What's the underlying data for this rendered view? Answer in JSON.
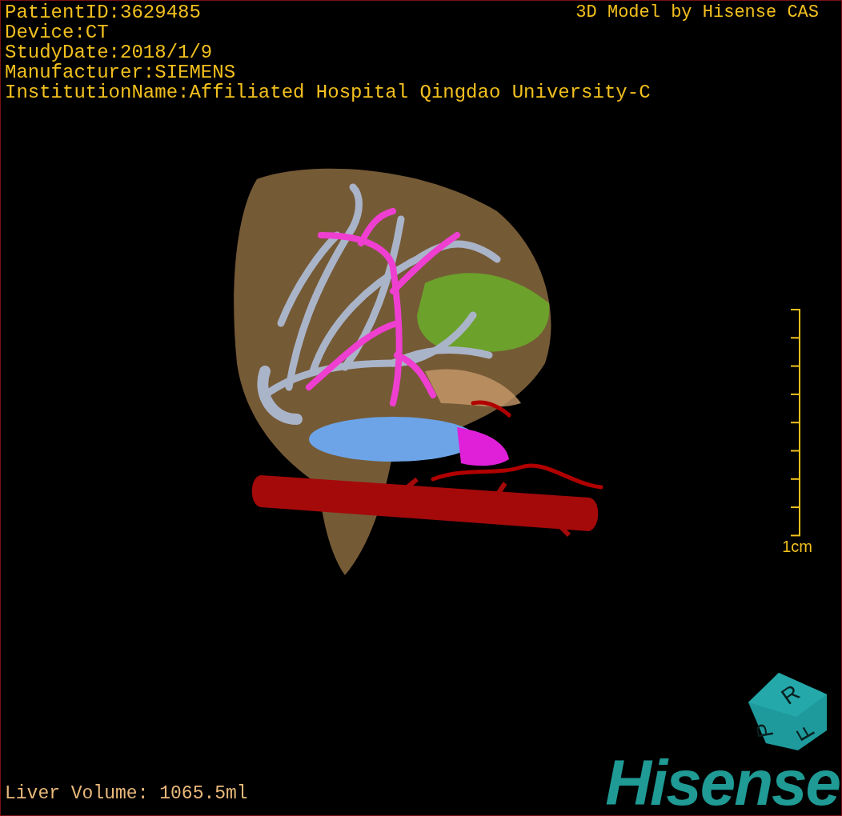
{
  "info_lines": [
    "PatientID:3629485",
    "Device:CT",
    "StudyDate:2018/1/9",
    "Manufacturer:SIEMENS",
    "InstitutionName:Affiliated Hospital Qingdao University-C"
  ],
  "title": "3D Model by Hisense CAS",
  "scale_bar": {
    "label": "1cm"
  },
  "liver_volume": "Liver Volume: 1065.5ml",
  "orientation_cube": {
    "faces": [
      "R",
      "P",
      "F"
    ]
  },
  "logo": "Hisense"
}
